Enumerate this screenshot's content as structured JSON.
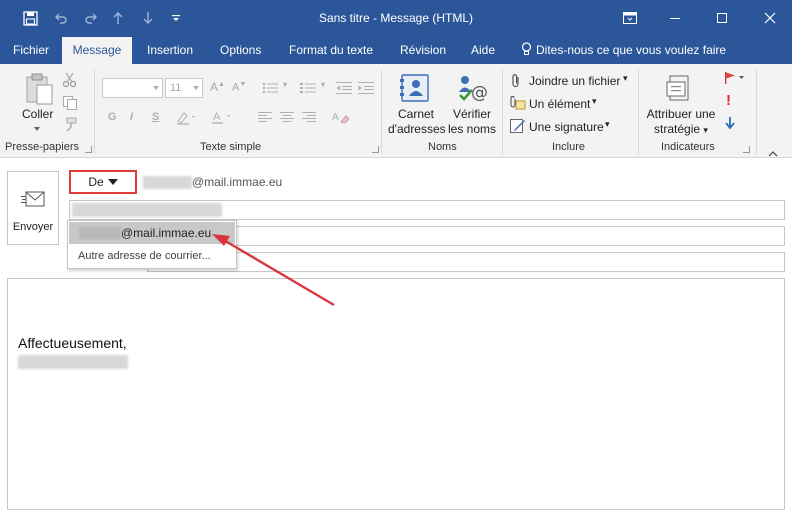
{
  "window": {
    "title": "Sans titre  -  Message (HTML)"
  },
  "tabs": [
    {
      "label": "Fichier"
    },
    {
      "label": "Message"
    },
    {
      "label": "Insertion"
    },
    {
      "label": "Options"
    },
    {
      "label": "Format du texte"
    },
    {
      "label": "Révision"
    },
    {
      "label": "Aide"
    }
  ],
  "tellme": {
    "label": "Dites-nous ce que vous voulez faire"
  },
  "ribbon": {
    "clipboard": {
      "paste_label": "Coller",
      "group_label": "Presse-papiers"
    },
    "basic_text": {
      "font_size": "11",
      "bold": "G",
      "italic": "I",
      "underline": "S",
      "group_label": "Texte simple"
    },
    "names": {
      "address_book_line1": "Carnet",
      "address_book_line2": "d'adresses",
      "check_names_line1": "Vérifier",
      "check_names_line2": "les noms",
      "group_label": "Noms"
    },
    "include": {
      "attach_file": "Joindre un fichier",
      "attach_item": "Un élément",
      "signature": "Une signature",
      "group_label": "Inclure"
    },
    "tags": {
      "policy_line1": "Attribuer une",
      "policy_line2": "stratégie",
      "group_label": "Indicateurs"
    }
  },
  "compose": {
    "send_label": "Envoyer",
    "from_button": "De",
    "from_value": "@mail.immae.eu",
    "dropdown": {
      "account": "@mail.immae.eu",
      "other": "Autre adresse de courrier..."
    },
    "body_text": "Affectueusement,"
  },
  "colors": {
    "titlebar": "#2b579a",
    "highlight_border": "#e03a3a",
    "annotation_arrow": "#d9363e"
  }
}
